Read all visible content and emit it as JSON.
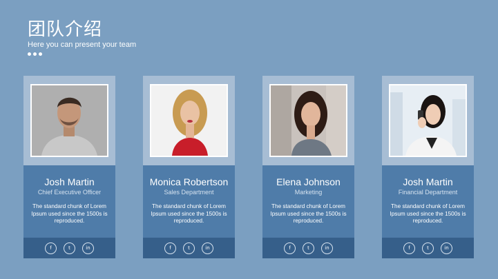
{
  "header": {
    "title": "团队介绍",
    "subtitle": "Here you can present your team"
  },
  "members": [
    {
      "name": "Josh Martin",
      "role": "Chief Executive Officer",
      "desc": "The standard chunk of Lorem Ipsum used since the 1500s is reproduced."
    },
    {
      "name": "Monica Robertson",
      "role": "Sales Department",
      "desc": "The standard chunk of Lorem Ipsum used since the 1500s is reproduced."
    },
    {
      "name": "Elena Johnson",
      "role": "Marketing",
      "desc": "The standard chunk of Lorem Ipsum used since the 1500s is reproduced."
    },
    {
      "name": "Josh Martin",
      "role": "Financial Department",
      "desc": "The standard chunk of Lorem Ipsum used since the 1500s is reproduced."
    }
  ],
  "social": {
    "facebook": "f",
    "twitter": "t",
    "linkedin": "in"
  },
  "colors": {
    "background": "#7b9fc1",
    "card_frame": "#a7bdd4",
    "info": "#4f7ca9",
    "social_bar": "#365f8a"
  }
}
